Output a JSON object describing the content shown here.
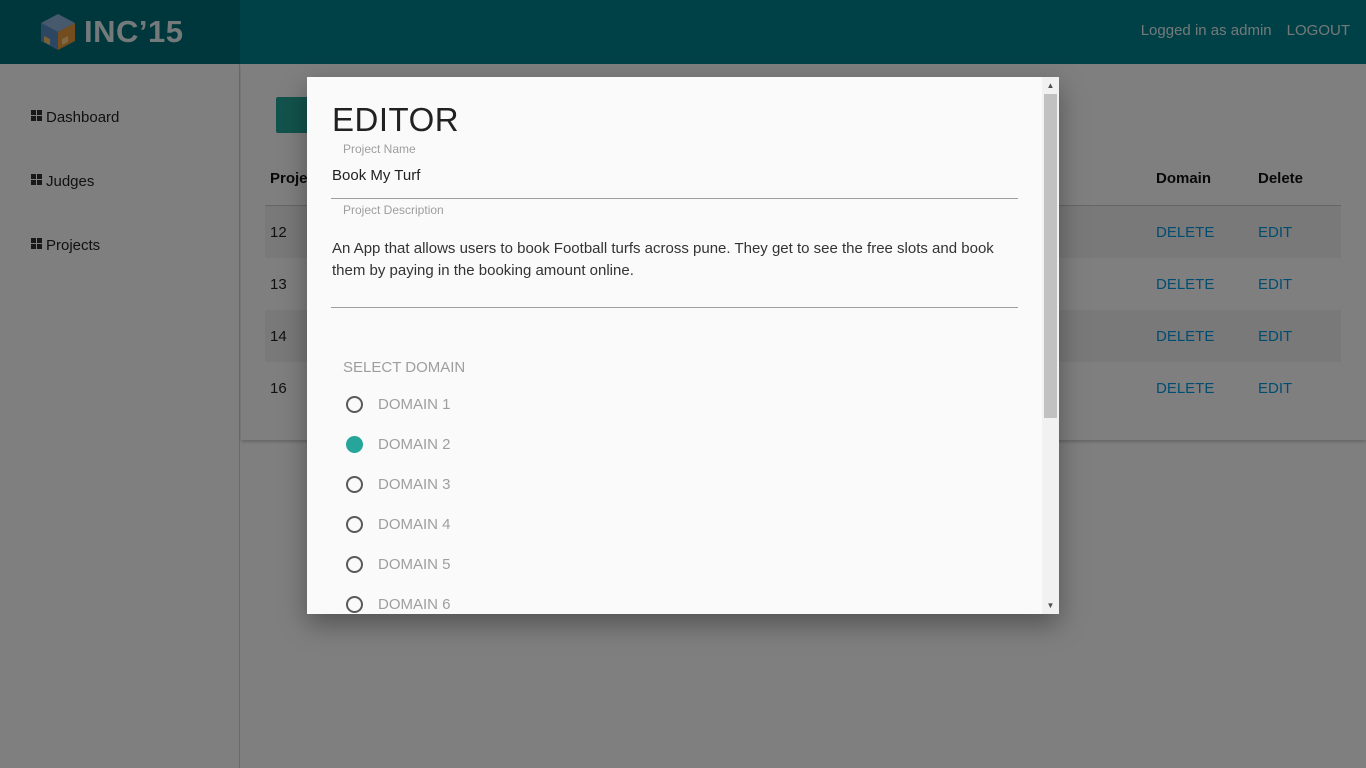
{
  "header": {
    "app_name": "INC’15",
    "logged_in_text": "Logged in as admin",
    "logout_label": "LOGOUT",
    "brand_color": "#00838f"
  },
  "sidebar": {
    "items": [
      {
        "label": "Dashboard",
        "icon": "dashboard-icon"
      },
      {
        "label": "Judges",
        "icon": "dashboard-icon"
      },
      {
        "label": "Projects",
        "icon": "dashboard-icon"
      }
    ]
  },
  "table": {
    "headers": [
      "Proje",
      "Domain",
      "Delete"
    ],
    "rows": [
      {
        "id": "12",
        "delete": "DELETE",
        "edit": "EDIT"
      },
      {
        "id": "13",
        "delete": "DELETE",
        "edit": "EDIT"
      },
      {
        "id": "14",
        "delete": "DELETE",
        "edit": "EDIT"
      },
      {
        "id": "16",
        "delete": "DELETE",
        "edit": "EDIT"
      }
    ]
  },
  "modal": {
    "title": "EDITOR",
    "project_name_label": "Project Name",
    "project_name_value": "Book My Turf",
    "project_description_label": "Project Description",
    "project_description_value": "An App that allows users to book Football turfs across pune. They get to see the free slots and book them by paying in the booking amount online.",
    "select_domain_label": "SELECT DOMAIN",
    "domains": [
      {
        "label": "DOMAIN 1",
        "checked": false
      },
      {
        "label": "DOMAIN 2",
        "checked": true
      },
      {
        "label": "DOMAIN 3",
        "checked": false
      },
      {
        "label": "DOMAIN 4",
        "checked": false
      },
      {
        "label": "DOMAIN 5",
        "checked": false
      },
      {
        "label": "DOMAIN 6",
        "checked": false
      }
    ],
    "accent_color": "#26a69a"
  },
  "icons": {
    "scroll_up": "▲",
    "scroll_down": "▼"
  }
}
